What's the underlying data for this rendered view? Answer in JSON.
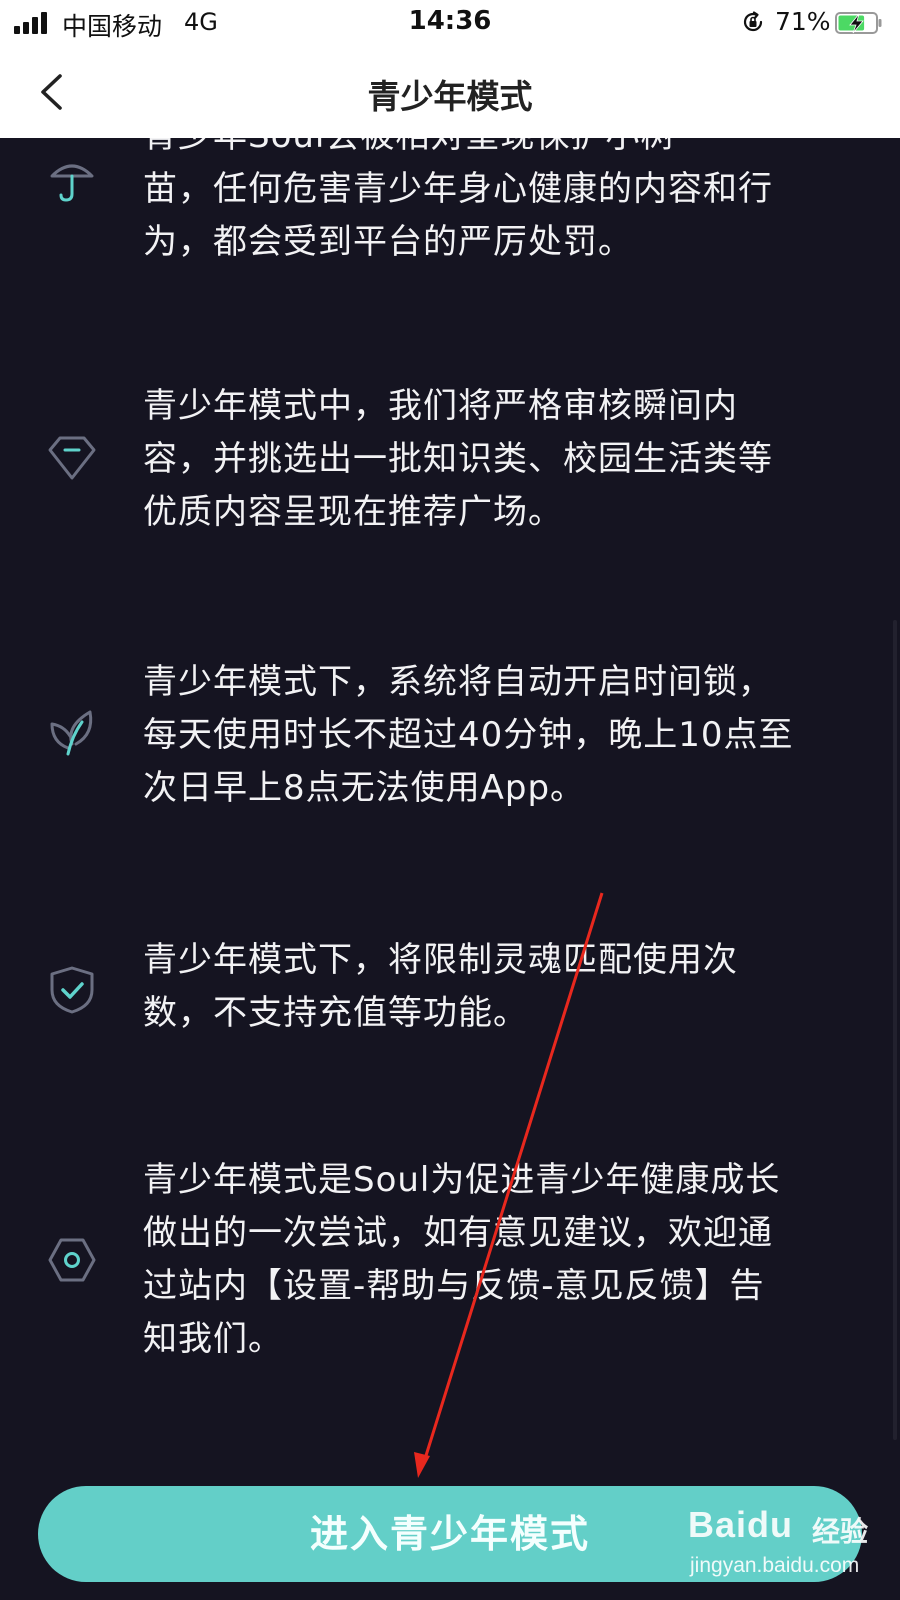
{
  "status_bar": {
    "carrier": "中国移动",
    "network": "4G",
    "time": "14:36",
    "battery_percent": "71%",
    "battery_level": 0.71
  },
  "nav": {
    "title": "青少年模式",
    "back_icon": "chevron-left-icon"
  },
  "items": [
    {
      "icon": "umbrella-icon",
      "lines": [
        "青少年Soul会被相对呈现保护小树",
        "苗，任何危害青少年身心健康的内容和行",
        "为，都会受到平台的严厉处罚。"
      ]
    },
    {
      "icon": "diamond-icon",
      "lines": [
        "青少年模式中，我们将严格审核瞬间内",
        "容，并挑选出一批知识类、校园生活类等",
        "优质内容呈现在推荐广场。"
      ]
    },
    {
      "icon": "leaf-icon",
      "lines": [
        "青少年模式下，系统将自动开启时间锁，",
        "每天使用时长不超过40分钟，晚上10点至",
        "次日早上8点无法使用App。"
      ]
    },
    {
      "icon": "shield-check-icon",
      "lines": [
        "青少年模式下，将限制灵魂匹配使用次",
        "数，不支持充值等功能。"
      ]
    },
    {
      "icon": "hexagon-icon",
      "lines": [
        "青少年模式是Soul为促进青少年健康成长",
        "做出的一次尝试，如有意见建议，欢迎通",
        "过站内【设置-帮助与反馈-意见反馈】告",
        "知我们。"
      ]
    }
  ],
  "button": {
    "label": "进入青少年模式"
  },
  "colors": {
    "background": "#151421",
    "accent": "#63cfc8",
    "annotation_arrow": "#e8281e"
  },
  "watermark": {
    "brand": "Baidu",
    "sub": "经验",
    "url": "jingyan.baidu.com"
  }
}
